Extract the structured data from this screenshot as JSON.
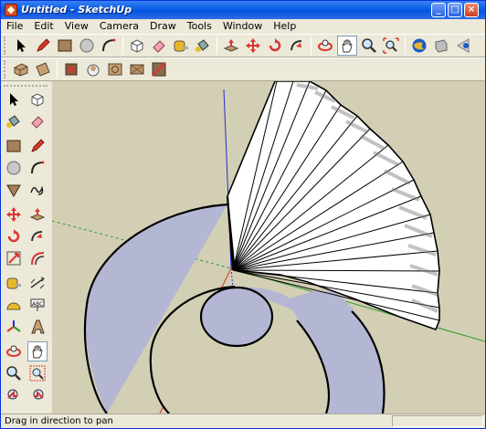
{
  "window": {
    "title": "Untitled - SketchUp",
    "controls": {
      "minimize": "_",
      "maximize": "□",
      "close": "×"
    }
  },
  "menu": [
    "File",
    "Edit",
    "View",
    "Camera",
    "Draw",
    "Tools",
    "Window",
    "Help"
  ],
  "toolbar_top": [
    "select-icon",
    "pencil-icon",
    "rectangle-icon",
    "circle-icon",
    "arc-icon",
    "make-component-icon",
    "eraser-icon",
    "tape-measure-icon",
    "paint-bucket-icon",
    "push-pull-icon",
    "move-icon",
    "rotate-icon",
    "follow-me-icon",
    "orbit-icon",
    "pan-icon",
    "zoom-icon",
    "zoom-extents-icon",
    "google-earth-icon",
    "get-models-icon",
    "share-model-icon"
  ],
  "toolbar_views": [
    "iso-view-icon",
    "top-view-icon",
    "front-view-icon",
    "right-view-icon",
    "back-view-icon",
    "left-view-icon",
    "section-view-icon"
  ],
  "toolbar_left": [
    "select-icon",
    "make-component-icon",
    "paint-bucket-icon",
    "eraser-icon",
    "rectangle-icon",
    "line-icon",
    "circle-icon",
    "arc-icon",
    "polygon-icon",
    "freehand-icon",
    "move-icon",
    "push-pull-icon",
    "rotate-icon",
    "follow-me-icon",
    "scale-icon",
    "offset-icon",
    "tape-measure-icon",
    "dimension-icon",
    "protractor-icon",
    "text-icon",
    "axes-icon",
    "3d-text-icon",
    "orbit-icon",
    "pan-icon",
    "zoom-icon",
    "zoom-window-icon",
    "previous-view-icon",
    "next-view-icon"
  ],
  "pressed_tool": "pan-icon",
  "status": {
    "text": "Drag in direction to pan",
    "measurement": ""
  },
  "colors": {
    "title_bar": "#0a5fe6",
    "window_face": "#ece9d8",
    "viewport_bg": "#d3cfb4",
    "face_back": "#b4b7d4",
    "face_front": "#ffffff",
    "axis_red": "#d33",
    "axis_green": "#2a9a2a",
    "axis_blue": "#2a2ad0"
  }
}
